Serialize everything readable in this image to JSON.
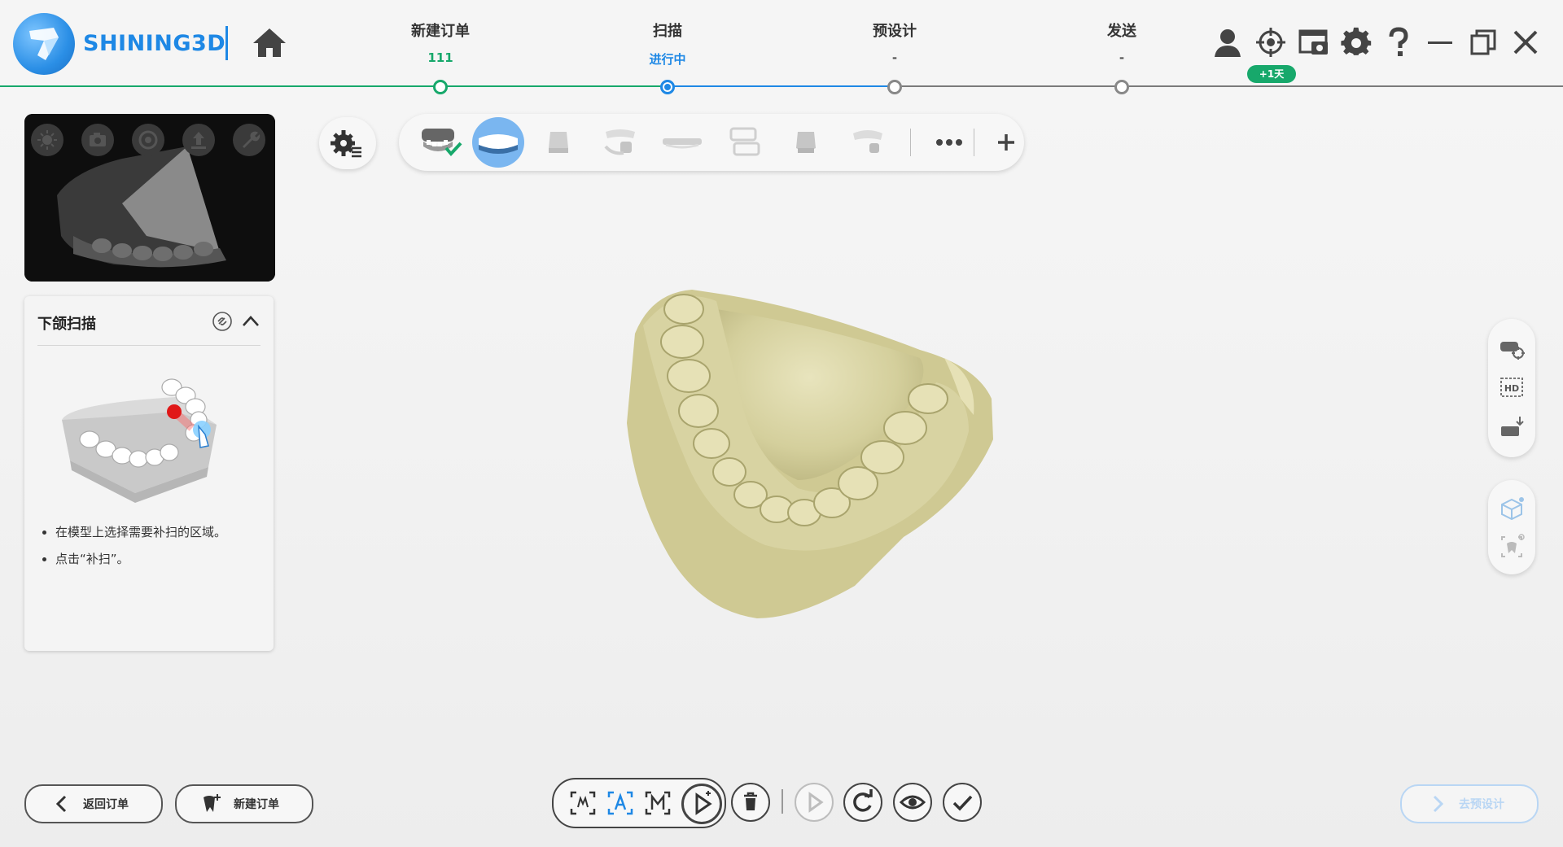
{
  "brand": {
    "name": "SHINING3D"
  },
  "steps": [
    {
      "title": "新建订单",
      "sub": "111",
      "sub_color": "#17a86b"
    },
    {
      "title": "扫描",
      "sub": "进行中",
      "sub_color": "#1e88e5"
    },
    {
      "title": "预设计",
      "sub": "-",
      "sub_color": "#555555"
    },
    {
      "title": "发送",
      "sub": "-",
      "sub_color": "#555555"
    }
  ],
  "header_icons": [
    "user-icon",
    "crosshair-icon",
    "screen-camera-icon",
    "gear-icon",
    "help-icon",
    "minimize-icon",
    "restore-icon",
    "close-icon"
  ],
  "badge": "+1天",
  "preview_buttons": [
    "brightness-icon",
    "camera-icon",
    "aperture-icon",
    "upload-icon",
    "wrench-icon"
  ],
  "panel": {
    "title": "下颌扫描",
    "instructions": [
      "在模型上选择需要补扫的区域。",
      "点击“补扫”。"
    ]
  },
  "toolbar": {
    "items": [
      "upper-jaw-done-icon",
      "lower-jaw-icon",
      "tooth-cap-icon",
      "bite-icon",
      "denture-icon",
      "layers-icon",
      "tooth-crown-icon",
      "bite-record-icon"
    ],
    "selected_index": 1
  },
  "bottom": {
    "back_label": "返回订单",
    "new_order_label": "新建订单",
    "next_label": "去预设计"
  },
  "colors": {
    "accent": "#1e88e5",
    "success": "#17a86b",
    "model": "#d9d5a6"
  }
}
